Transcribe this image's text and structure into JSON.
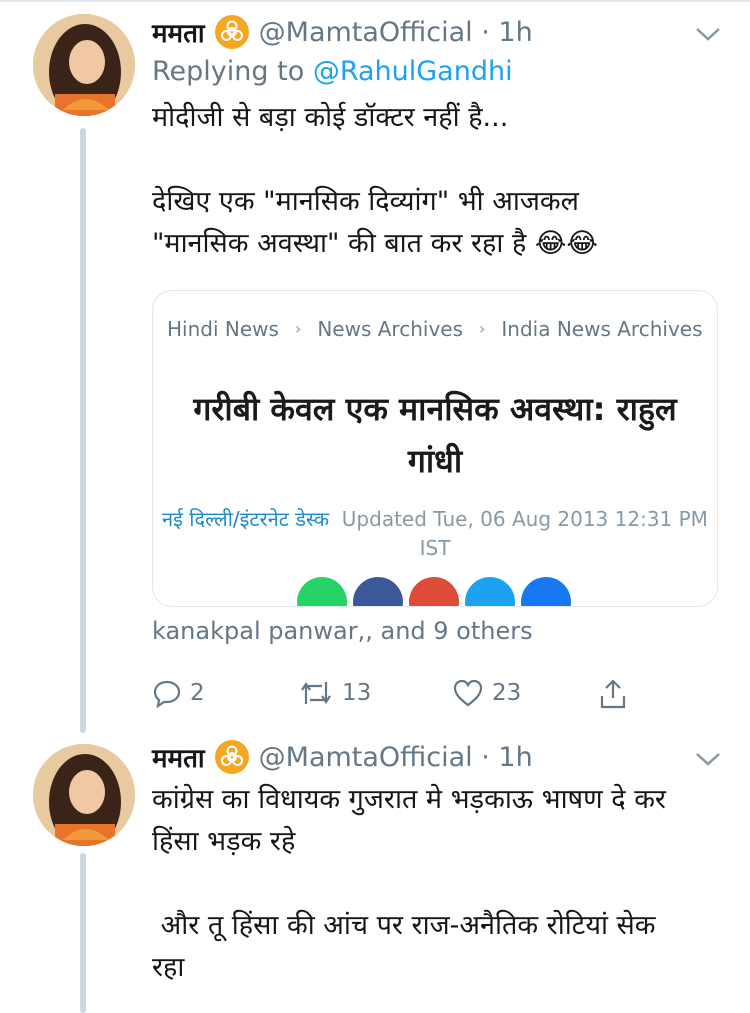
{
  "tweets": [
    {
      "name": "ममता",
      "handle_time": "@MamtaOfficial · 1h",
      "replying_prefix": "Replying to",
      "replying_user": "@RahulGandhi",
      "lines": [
        "मोदीजी से बड़ा कोई डॉक्टर नहीं है...",
        "",
        "देखिए एक \"मानसिक दिव्यांग\" भी आजकल",
        "\"मानसिक अवस्था\" की बात कर रहा है 😂😂"
      ],
      "card": {
        "breadcrumbs": [
          "Hindi News",
          "News Archives",
          "India News Archives"
        ],
        "headline_line1": "गरीबी केवल एक मानसिक अवस्था: राहुल",
        "headline_line2": "गांधी",
        "desk": "नई दिल्ली/इंटरनेट डेस्क",
        "updated_line1": "Updated Tue, 06 Aug 2013 12:31 PM",
        "updated_line2": "IST",
        "share_colors": [
          "#25d366",
          "#3b5998",
          "#dd4b39",
          "#1da1f2",
          "#1877f2"
        ]
      },
      "liked_by": "kanakpal panwar,, and 9 others",
      "actions": {
        "replies": "2",
        "retweets": "13",
        "likes": "23"
      }
    },
    {
      "name": "ममता",
      "handle_time": "@MamtaOfficial · 1h",
      "lines": [
        "कांग्रेस का विधायक गुजरात मे भड़काऊ भाषण दे कर",
        "हिंसा भड़क रहे",
        "",
        " और तू हिंसा की आंच पर राज-अनैतिक रोटियां सेक",
        "रहा"
      ]
    }
  ],
  "colors": {
    "text": "#14171a",
    "secondary": "#657786",
    "link": "#1da1f2",
    "badge": "#f5a623",
    "thread_line": "#ccd6dd"
  },
  "icons": [
    "caret-down-icon",
    "biohazard-icon",
    "reply-icon",
    "retweet-icon",
    "like-icon",
    "share-icon"
  ]
}
